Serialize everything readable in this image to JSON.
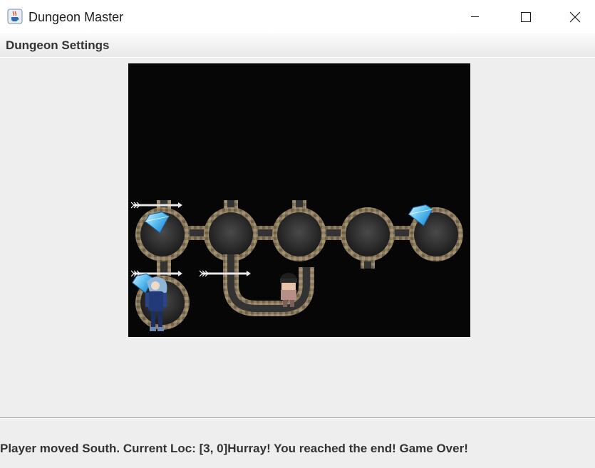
{
  "window": {
    "title": "Dungeon Master",
    "icon": "java-coffee-cup-icon",
    "controls": [
      "minimize-icon",
      "maximize-icon",
      "close-icon"
    ]
  },
  "menu": {
    "items": [
      {
        "label": "Dungeon Settings"
      }
    ]
  },
  "game": {
    "grid": {
      "rows": 4,
      "cols": 5
    },
    "player_location": [
      3,
      0
    ],
    "sprites": [
      "diamond-icon",
      "arrow-icon",
      "hero-sprite",
      "masked-thief-sprite"
    ]
  },
  "status": {
    "message": "Player moved South. Current Loc: [3, 0]Hurray! You reached the end! Game Over!"
  },
  "colors": {
    "window_bg": "#eeeeee",
    "canvas_bg": "#060606",
    "stone_wall": "#8a7a5e",
    "floor": "#3a3a3a",
    "gem": "#5fc8f5"
  }
}
